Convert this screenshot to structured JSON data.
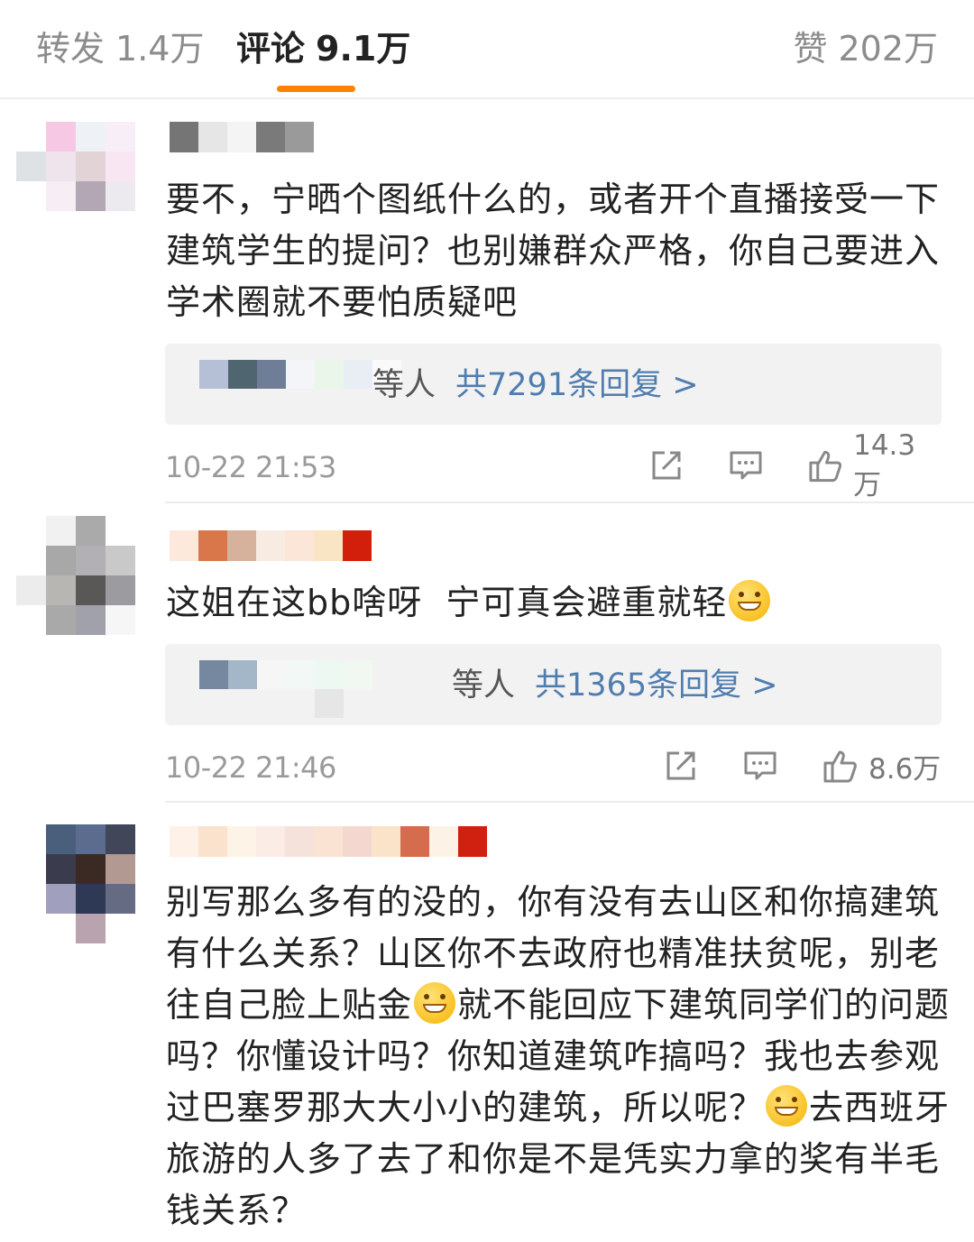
{
  "tabs": {
    "repost": {
      "label": "转发",
      "count": "1.4万"
    },
    "comments": {
      "label": "评论",
      "count": "9.1万"
    },
    "likes": {
      "label": "赞",
      "count": "202万"
    }
  },
  "colors": {
    "accent": "#ff8200",
    "link": "#507daf",
    "text": "#222222",
    "meta": "#9a9a9a"
  },
  "icons": {
    "repost": "repost-icon",
    "comment": "comment-icon",
    "like": "thumbs-up-icon",
    "emoji": "grinning-face-emoji"
  },
  "comments": [
    {
      "text_parts": [
        "要不，宁晒个图纸什么的，或者开个直播接受一下建筑学生的提问？也别嫌群众严格，你自己要进入学术圈就不要怕质疑吧"
      ],
      "replies": {
        "who": "等人",
        "count": "共7291条回复 >"
      },
      "time": "10-22 21:53",
      "likes": "14.3万"
    },
    {
      "text_parts": [
        "这姐在这bb啥呀  宁可真会避重就轻"
      ],
      "replies": {
        "who": "等人",
        "count": "共1365条回复 >"
      },
      "time": "10-22 21:46",
      "likes": "8.6万"
    },
    {
      "text_parts": [
        "别写那么多有的没的，你有没有去山区和你搞建筑有什么关系？山区你不去政府也精准扶贫呢，别老往自己脸上贴金",
        "就不能回应下建筑同学们的问题吗？你懂设计吗？你知道建筑咋搞吗？我也去参观过巴塞罗那大大小小的建筑，所以呢？",
        "去西班牙旅游的人多了去了和你是不是凭实力拿的奖有半毛钱关系？"
      ]
    }
  ]
}
